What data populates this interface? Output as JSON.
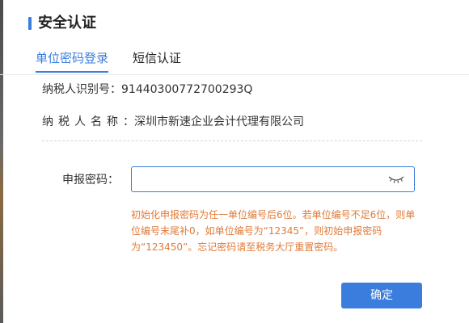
{
  "dialog": {
    "title": "安全认证",
    "accent_color": "#3b7ddd"
  },
  "tabs": [
    {
      "label": "单位密码登录",
      "active": true
    },
    {
      "label": "短信认证",
      "active": false
    }
  ],
  "taxpayer": {
    "id_label": "纳税人识别号：",
    "id_value": "91440300772700293Q",
    "name_label": "纳税人名称",
    "name_colon": "：",
    "name_value": "深圳市新速企业会计代理有限公司"
  },
  "password_field": {
    "label": "申报密码：",
    "value": "",
    "placeholder": "",
    "icon": "eye-closed-icon"
  },
  "hint": {
    "text": "初始化申报密码为任一单位编号后6位。若单位编号不足6位，则单位编号末尾补0，如单位编号为“12345”，则初始申报密码为“123450”。忘记密码请至税务大厅重置密码。",
    "color": "#e07b39"
  },
  "buttons": {
    "confirm_label": "确定"
  }
}
